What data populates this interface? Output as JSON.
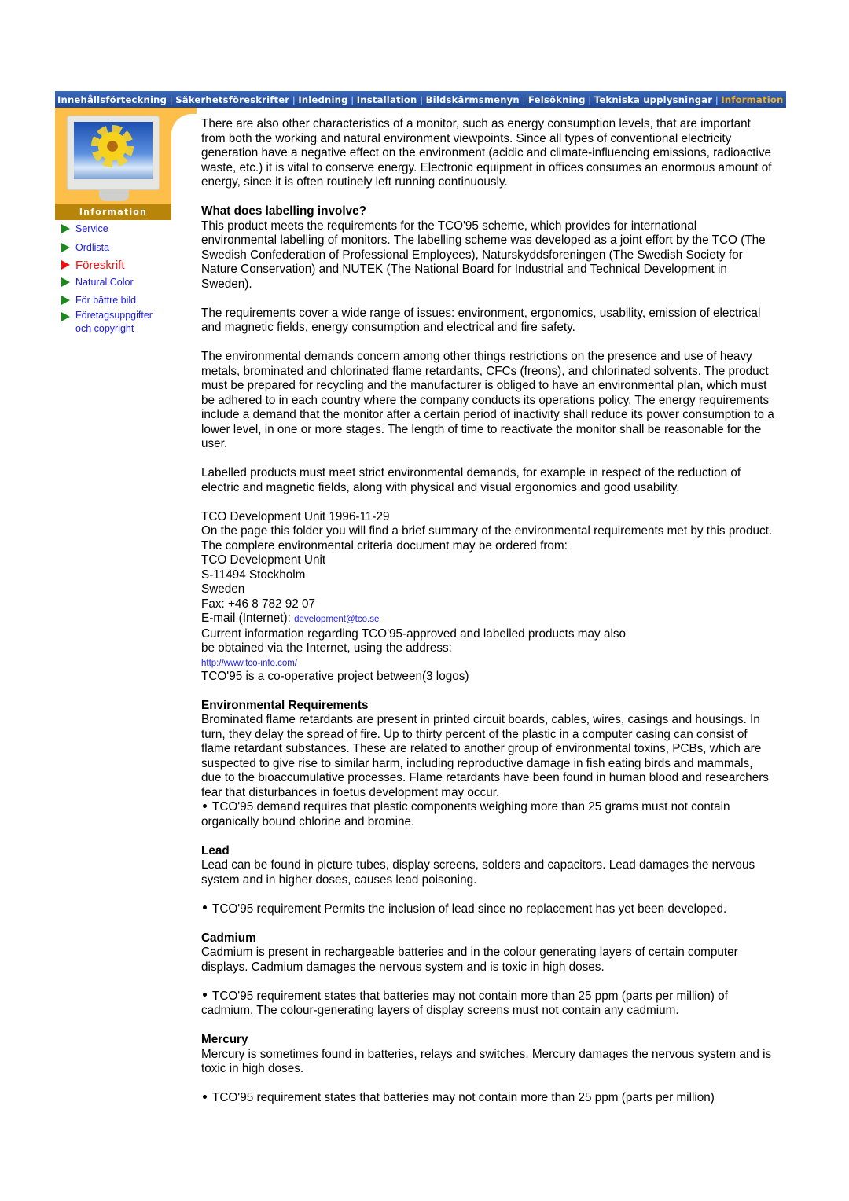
{
  "nav": {
    "items": [
      {
        "label": "Innehållsförteckning",
        "active": false
      },
      {
        "label": "Säkerhetsföreskrifter",
        "active": false
      },
      {
        "label": "Inledning",
        "active": false
      },
      {
        "label": "Installation",
        "active": false
      },
      {
        "label": "Bildskärmsmenyn",
        "active": false
      },
      {
        "label": "Felsökning",
        "active": false
      },
      {
        "label": "Tekniska upplysningar",
        "active": false
      },
      {
        "label": "Information",
        "active": true
      }
    ],
    "separator": "|",
    "colors": {
      "bar": "#2a55a8",
      "active": "#f3b020",
      "text": "#ffffff"
    }
  },
  "side_panel": {
    "label": "Information",
    "colors": {
      "background": "#fdbf4a",
      "label_bar": "#b8850a"
    }
  },
  "sidebar": {
    "items": [
      {
        "label": "Service",
        "current": false
      },
      {
        "label": "Ordlista",
        "current": false
      },
      {
        "label": "Föreskrift",
        "current": true
      },
      {
        "label": "Natural Color",
        "current": false
      },
      {
        "label": "För bättre bild",
        "current": false
      },
      {
        "label": "Företagsuppgifter och copyright",
        "line1": "Företagsuppgifter",
        "line2": "och copyright",
        "current": false
      }
    ],
    "colors": {
      "link": "#1a1aee",
      "current": "#ee1111",
      "arrow": "#1a8a1a"
    }
  },
  "content": {
    "intro": "There are also other characteristics of a monitor, such as energy consumption levels, that are important from both the working and natural environment viewpoints. Since all types of conventional electricity generation have a negative effect on the environment (acidic and climate-influencing emissions, radioactive waste, etc.) it is vital to conserve energy. Electronic equipment in offices consumes an enormous amount of energy, since it is often routinely left running continuously.",
    "labelling": {
      "heading": "What does labelling involve?",
      "p1": "This product meets the requirements for the TCO'95 scheme, which provides for international environmental labelling of monitors. The labelling scheme was developed as a joint effort by the TCO (The Swedish Confederation of Professional Employees), Naturskyddsforeningen (The Swedish Society for Nature Conservation) and NUTEK (The National Board for Industrial and Technical Development in Sweden).",
      "p2": "The requirements cover a wide range of issues: environment, ergonomics, usability, emission of electrical and magnetic fields, energy consumption and electrical and fire safety.",
      "p3": "The environmental demands concern among other things restrictions on the presence and use of heavy metals, brominated and chlorinated flame retardants, CFCs (freons), and chlorinated solvents. The product must be prepared for recycling and the manufacturer is obliged to have an environmental plan, which must be adhered to in each country where the company conducts its operations policy. The energy requirements include a demand that the monitor after a certain period of inactivity shall reduce its power consumption to a lower level, in one or more stages. The length of time to reactivate the monitor shall be reasonable for the user.",
      "p4": "Labelled products must meet strict environmental demands, for example in respect of the reduction of electric and magnetic fields, along with physical and visual ergonomics and good usability."
    },
    "contact": {
      "line1": "TCO Development Unit 1996-11-29",
      "line2": "On the page this folder you will find a brief summary of the environmental requirements met by this product.",
      "line3": "The complere environmental criteria document may be ordered from:",
      "org": "TCO Development Unit",
      "city": "S-11494 Stockholm",
      "country": "Sweden",
      "fax": "Fax: +46 8 782 92 07",
      "email_label": "E-mail (Internet): ",
      "email": "development@tco.se",
      "info1": "Current information regarding TCO'95-approved and labelled products may also",
      "info2": "be obtained via the Internet, using the address:",
      "url": "http://www.tco-info.com/",
      "coop": "TCO'95 is a co-operative project between(3 logos)"
    },
    "env": {
      "heading": "Environmental Requirements",
      "text": "Brominated flame retardants are present in printed circuit boards, cables, wires, casings and housings. In turn, they delay the spread of fire. Up to thirty percent of the plastic in a computer casing can consist of flame retardant substances. These are related to another group of environmental toxins, PCBs, which are suspected to give rise to similar harm, including reproductive damage in fish eating birds and mammals, due to the bioaccumulative processes. Flame retardants have been found in human blood and researchers fear that disturbances in foetus development may occur.",
      "bullet": "TCO'95 demand requires that plastic components weighing more than 25 grams must not contain organically bound chlorine and bromine."
    },
    "lead": {
      "heading": "Lead",
      "text": "Lead can be found in picture tubes, display screens, solders and capacitors. Lead damages the nervous system and in higher doses, causes lead poisoning.",
      "bullet": "TCO'95 requirement Permits the inclusion of lead since no replacement has yet been developed."
    },
    "cadmium": {
      "heading": "Cadmium",
      "text": "Cadmium is present in rechargeable batteries and in the colour generating layers of certain computer displays. Cadmium damages the nervous system and is toxic in high doses.",
      "bullet": "TCO'95 requirement states that batteries may not contain more than 25 ppm (parts per million) of cadmium. The colour-generating layers of display screens must not contain any cadmium."
    },
    "mercury": {
      "heading": "Mercury",
      "text": "Mercury is sometimes found in batteries, relays and switches. Mercury damages the nervous system and is toxic in high doses.",
      "bullet": "TCO'95 requirement states that batteries may not contain more than 25 ppm (parts per million)"
    }
  }
}
